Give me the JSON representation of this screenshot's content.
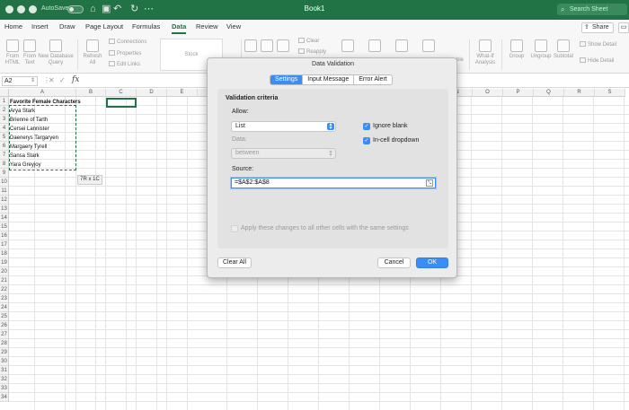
{
  "window": {
    "title": "Book1"
  },
  "titlebar": {
    "autosave_label": "AutoSave",
    "toggle_state": "OFF",
    "search_placeholder": "Search Sheet"
  },
  "ribbon_tabs": [
    {
      "label": "Home"
    },
    {
      "label": "Insert"
    },
    {
      "label": "Draw"
    },
    {
      "label": "Page Layout"
    },
    {
      "label": "Formulas"
    },
    {
      "label": "Data",
      "active": true
    },
    {
      "label": "Review"
    },
    {
      "label": "View"
    }
  ],
  "share_label": "Share",
  "ribbon": {
    "from_html": "From\nHTML",
    "from_text": "From\nText",
    "new_database_query": "New Database\nQuery",
    "refresh_all": "Refresh\nAll",
    "connections": "Connections",
    "properties": "Properties",
    "edit_links": "Edit Links",
    "clear": "Clear",
    "reapply": "Reapply",
    "what_if": "What-If\nAnalysis",
    "group": "Group",
    "ungroup": "Ungroup",
    "subtotal": "Subtotal",
    "show_detail": "Show Detail",
    "hide_detail": "Hide Detail",
    "ble": "ble",
    "stock": "Stock"
  },
  "formula_bar": {
    "name_box": "A2",
    "fx": "fx"
  },
  "columns": [
    "A",
    "B",
    "C",
    "D",
    "E",
    "F",
    "G",
    "H",
    "I",
    "J",
    "K",
    "L",
    "M",
    "N",
    "O",
    "P",
    "Q",
    "R",
    "S"
  ],
  "rows": [
    "1",
    "2",
    "3",
    "4",
    "5",
    "6",
    "7",
    "8",
    "9",
    "10",
    "11",
    "12",
    "13",
    "14",
    "15",
    "16",
    "17",
    "18",
    "19",
    "20",
    "21",
    "22",
    "23",
    "24",
    "25",
    "26",
    "27",
    "28",
    "29",
    "30",
    "31",
    "32",
    "33",
    "34",
    "35"
  ],
  "cells": [
    "Favorite Female Characters",
    "Arya Stark",
    "Brienne of Tarth",
    "Cersei Lannister",
    "Daenerys Targaryen",
    "Margaery Tyrell",
    "Sansa Stark",
    "Yara Greyjoy"
  ],
  "selection_tooltip": "7R x 1C",
  "dialog": {
    "title": "Data Validation",
    "tabs": [
      {
        "label": "Settings",
        "active": true
      },
      {
        "label": "Input Message"
      },
      {
        "label": "Error Alert"
      }
    ],
    "criteria_heading": "Validation criteria",
    "allow_label": "Allow:",
    "allow_value": "List",
    "ignore_blank_label": "Ignore blank",
    "ignore_blank_checked": true,
    "in_cell_dropdown_label": "In-cell dropdown",
    "in_cell_dropdown_checked": true,
    "data_label": "Data:",
    "data_value": "between",
    "source_label": "Source:",
    "source_value": "=$A$2:$A$8",
    "apply_all_label": "Apply these changes to all other cells with the same settings",
    "clear_all_label": "Clear All",
    "cancel_label": "Cancel",
    "ok_label": "OK"
  },
  "colors": {
    "excel_green": "#217346",
    "accent_blue": "#3a8df5"
  }
}
